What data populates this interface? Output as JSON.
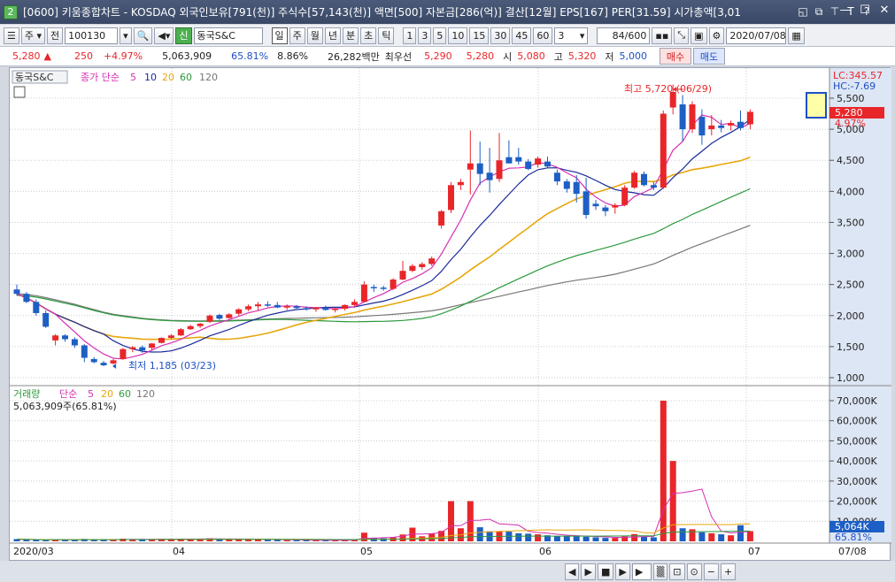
{
  "window": {
    "number": "2",
    "title": "[0600] 키움종합차트 - KOSDAQ 외국인보유[791(천)] 주식수[57,143(천)] 액면[500] 자본금[286(억)] 결산[12월] EPS[167] PER[31.59] 시가총액[3,01"
  },
  "toolbar": {
    "period_select": "주",
    "prev_label": "전",
    "code": "100130",
    "name": "동국S&C",
    "new_label": "신",
    "periods": [
      "일",
      "주",
      "월",
      "년",
      "분",
      "초",
      "틱"
    ],
    "intervals": [
      "1",
      "3",
      "5",
      "10",
      "15",
      "30",
      "45",
      "60"
    ],
    "custom_interval": "3",
    "count": "84/600",
    "date": "2020/07/08"
  },
  "quote": {
    "price": "5,280",
    "arrow": "▲",
    "change": "250",
    "rate": "+4.97%",
    "volume": "5,063,909",
    "vol_ratio": "65.81%",
    "turnover": "8.86%",
    "amount": "26,282백만",
    "best_label": "최우선",
    "bid": "5,290",
    "ask": "5,280",
    "open_label": "시",
    "open": "5,080",
    "high_label": "고",
    "high": "5,320",
    "low_label": "저",
    "low": "5,000",
    "buy_label": "매수",
    "sell_label": "매도"
  },
  "price_panel": {
    "legend_name": "동국S&C",
    "legend_ma": "종가 단순",
    "ma_periods": [
      "5",
      "10",
      "20",
      "60",
      "120"
    ],
    "lc": "LC:345.57",
    "hc": "HC:-7.69",
    "last_price": "5,280",
    "last_rate": "4.97%",
    "max_annotation": "최고 5,720 (06/29)",
    "min_annotation": "최저 1,185 (03/23)",
    "yticks": [
      "5,500",
      "5,000",
      "4,500",
      "4,000",
      "3,500",
      "3,000",
      "2,500",
      "2,000",
      "1,500",
      "1,000"
    ]
  },
  "volume_panel": {
    "legend_name": "거래량",
    "legend_ma": "단순",
    "ma_periods": [
      "5",
      "20",
      "60",
      "120"
    ],
    "volume_text": "5,063,909주(65.81%)",
    "yticks": [
      "70,000K",
      "60,000K",
      "50,000K",
      "40,000K",
      "30,000K",
      "20,000K",
      "10,000K"
    ],
    "last_volume": "5,064K",
    "last_ratio": "65.81%"
  },
  "xaxis": {
    "labels": [
      "2020/03",
      "04",
      "05",
      "06",
      "07",
      "07/08"
    ]
  },
  "colors": {
    "up": "#e8262a",
    "down": "#1d5fc4",
    "ma5": "#d62fb4",
    "ma10": "#1a2a9a",
    "ma20": "#e8a70c",
    "ma60": "#2c9a3c",
    "ma120": "#777777"
  },
  "chart_data": {
    "type": "candlestick",
    "candles": [
      [
        2420,
        2500,
        2320,
        2350
      ],
      [
        2350,
        2380,
        2200,
        2220
      ],
      [
        2220,
        2260,
        2000,
        2040
      ],
      [
        2040,
        2080,
        1800,
        1820
      ],
      [
        1600,
        1700,
        1520,
        1680
      ],
      [
        1680,
        1700,
        1580,
        1620
      ],
      [
        1620,
        1650,
        1480,
        1520
      ],
      [
        1520,
        1540,
        1250,
        1320
      ],
      [
        1300,
        1330,
        1230,
        1250
      ],
      [
        1240,
        1270,
        1185,
        1200
      ],
      [
        1230,
        1300,
        1210,
        1280
      ],
      [
        1300,
        1480,
        1290,
        1460
      ],
      [
        1460,
        1510,
        1410,
        1490
      ],
      [
        1490,
        1520,
        1400,
        1440
      ],
      [
        1480,
        1560,
        1440,
        1550
      ],
      [
        1560,
        1650,
        1550,
        1640
      ],
      [
        1640,
        1700,
        1620,
        1680
      ],
      [
        1680,
        1800,
        1670,
        1780
      ],
      [
        1780,
        1850,
        1770,
        1830
      ],
      [
        1830,
        1880,
        1800,
        1870
      ],
      [
        1900,
        2020,
        1880,
        2000
      ],
      [
        2010,
        2030,
        1930,
        1950
      ],
      [
        1960,
        2040,
        1950,
        2020
      ],
      [
        2030,
        2120,
        2000,
        2100
      ],
      [
        2100,
        2180,
        2070,
        2150
      ],
      [
        2150,
        2220,
        2080,
        2180
      ],
      [
        2180,
        2230,
        2140,
        2170
      ],
      [
        2170,
        2220,
        2120,
        2130
      ],
      [
        2130,
        2180,
        2090,
        2150
      ],
      [
        2150,
        2170,
        2110,
        2120
      ],
      [
        2120,
        2150,
        2080,
        2100
      ],
      [
        2100,
        2140,
        2060,
        2130
      ],
      [
        2130,
        2160,
        2080,
        2090
      ],
      [
        2090,
        2130,
        2050,
        2110
      ],
      [
        2110,
        2180,
        2080,
        2170
      ],
      [
        2170,
        2260,
        2140,
        2220
      ],
      [
        2220,
        2550,
        2220,
        2500
      ],
      [
        2460,
        2500,
        2380,
        2450
      ],
      [
        2450,
        2480,
        2400,
        2430
      ],
      [
        2430,
        2600,
        2410,
        2580
      ],
      [
        2580,
        2880,
        2570,
        2720
      ],
      [
        2720,
        2830,
        2700,
        2800
      ],
      [
        2780,
        2860,
        2740,
        2830
      ],
      [
        2830,
        2950,
        2800,
        2920
      ],
      [
        3450,
        3700,
        3400,
        3680
      ],
      [
        3700,
        4150,
        3650,
        4100
      ],
      [
        4100,
        4200,
        4020,
        4150
      ],
      [
        4350,
        4980,
        3950,
        4450
      ],
      [
        4450,
        4800,
        4100,
        4280
      ],
      [
        4300,
        4700,
        3980,
        4180
      ],
      [
        4200,
        4940,
        4150,
        4500
      ],
      [
        4550,
        4820,
        4450,
        4450
      ],
      [
        4550,
        4700,
        4430,
        4480
      ],
      [
        4480,
        4520,
        4340,
        4360
      ],
      [
        4430,
        4560,
        4380,
        4530
      ],
      [
        4480,
        4560,
        4380,
        4400
      ],
      [
        4300,
        4350,
        4100,
        4160
      ],
      [
        4160,
        4200,
        3980,
        4040
      ],
      [
        4150,
        4260,
        3820,
        3960
      ],
      [
        4000,
        4220,
        3560,
        3620
      ],
      [
        3800,
        3860,
        3700,
        3760
      ],
      [
        3740,
        3780,
        3600,
        3680
      ],
      [
        3740,
        3810,
        3640,
        3780
      ],
      [
        3780,
        4100,
        3760,
        4060
      ],
      [
        4060,
        4330,
        4040,
        4300
      ],
      [
        4280,
        4320,
        4080,
        4100
      ],
      [
        4100,
        4150,
        4020,
        4060
      ],
      [
        4060,
        5300,
        4040,
        5250
      ],
      [
        5350,
        5720,
        5240,
        5600
      ],
      [
        5400,
        5550,
        4800,
        5000
      ],
      [
        5000,
        5450,
        4940,
        5400
      ],
      [
        5200,
        5320,
        4750,
        4900
      ],
      [
        5000,
        5230,
        4900,
        5060
      ],
      [
        5060,
        5150,
        4950,
        5020
      ],
      [
        5060,
        5140,
        4980,
        5100
      ],
      [
        5120,
        5300,
        4980,
        5020
      ],
      [
        5080,
        5320,
        5000,
        5280
      ]
    ],
    "volume_k": [
      1100,
      800,
      700,
      600,
      900,
      800,
      700,
      1200,
      900,
      700,
      800,
      1300,
      1000,
      800,
      1000,
      1200,
      900,
      1300,
      1100,
      1200,
      1500,
      900,
      900,
      1200,
      1000,
      900,
      700,
      700,
      600,
      600,
      600,
      600,
      500,
      500,
      700,
      900,
      4300,
      1800,
      1500,
      2000,
      3400,
      6800,
      2500,
      4000,
      5200,
      20000,
      6500,
      20000,
      7000,
      5000,
      5000,
      4800,
      4000,
      3800,
      3500,
      3000,
      2500,
      2500,
      2500,
      2300,
      2000,
      1700,
      1700,
      2500,
      3600,
      2500,
      2000,
      70000,
      40000,
      6500,
      6000,
      4500,
      4000,
      3500,
      3000,
      8000,
      5064
    ],
    "ma5_vol_k": [
      1000,
      900,
      850,
      800,
      750,
      800,
      800,
      850,
      900,
      850,
      850,
      900,
      1000,
      1000,
      1000,
      1050,
      1050,
      1100,
      1100,
      1150,
      1200,
      1200,
      1150,
      1150,
      1100,
      1100,
      1000,
      900,
      800,
      700,
      650,
      600,
      580,
      560,
      560,
      600,
      1400,
      1600,
      1800,
      2000,
      2600,
      3600,
      3600,
      3800,
      4400,
      7700,
      7800,
      10400,
      10500,
      11000,
      8700,
      8400,
      8000,
      5000,
      4400,
      4100,
      3500,
      3100,
      2800,
      2600,
      2400,
      2200,
      2000,
      2000,
      2200,
      2300,
      2400,
      15700,
      23800,
      24200,
      25000,
      26000,
      12200,
      5000,
      4200,
      4500,
      5000
    ]
  }
}
